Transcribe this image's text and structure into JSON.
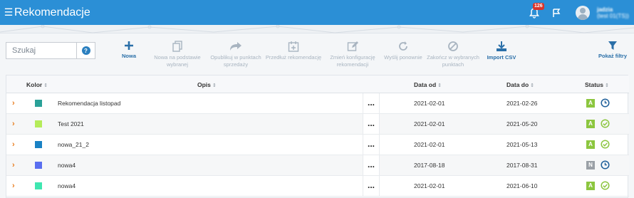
{
  "topbar": {
    "menu_icon": "hamburger-icon",
    "title": "Rekomendacje",
    "notification_count": "126",
    "user_name": "jadzia",
    "user_detail": "(test 01(TS))"
  },
  "search": {
    "placeholder": "Szukaj",
    "help_label": "?"
  },
  "toolbar": [
    {
      "label": "Nowa",
      "icon": "plus-icon",
      "enabled": true
    },
    {
      "label": "Nowa na podstawie\nwybranej",
      "icon": "copy-icon",
      "enabled": false
    },
    {
      "label": "Opublikuj w punktach\nsprzedaży",
      "icon": "share-icon",
      "enabled": false
    },
    {
      "label": "Przedłuż rekomendację",
      "icon": "calendar-plus-icon",
      "enabled": false
    },
    {
      "label": "Zmień konfigurację\nrekomendacji",
      "icon": "edit-icon",
      "enabled": false
    },
    {
      "label": "Wyślij ponownie",
      "icon": "refresh-icon",
      "enabled": false
    },
    {
      "label": "Zakończ w wybranych\npunktach",
      "icon": "ban-icon",
      "enabled": false
    },
    {
      "label": "Import CSV",
      "icon": "download-icon",
      "enabled": true
    },
    {
      "label": "Pokaż filtry",
      "icon": "filter-icon",
      "enabled": true
    }
  ],
  "table": {
    "columns": {
      "kolor": "Kolor",
      "opis": "Opis",
      "data_od": "Data od",
      "data_do": "Data do",
      "status": "Status"
    },
    "more_label": "...",
    "rows": [
      {
        "color": "#2aa198",
        "opis": "Rekomendacja listopad",
        "data_od": "2021-02-01",
        "data_do": "2021-02-26",
        "status": "A",
        "status_color": "#8cc63f",
        "status_icon": "clock-icon"
      },
      {
        "color": "#b5ec5a",
        "opis": "Test 2021",
        "data_od": "2021-02-01",
        "data_do": "2021-05-20",
        "status": "A",
        "status_color": "#8cc63f",
        "status_icon": "check-circle-icon"
      },
      {
        "color": "#1a82c4",
        "opis": "nowa_21_2",
        "data_od": "2021-02-01",
        "data_do": "2021-05-13",
        "status": "A",
        "status_color": "#8cc63f",
        "status_icon": "check-circle-icon"
      },
      {
        "color": "#5a6ff0",
        "opis": "nowa4",
        "data_od": "2017-08-18",
        "data_do": "2017-08-31",
        "status": "N",
        "status_color": "#9aa0a6",
        "status_icon": "clock-icon"
      },
      {
        "color": "#3fe6b0",
        "opis": "nowa4",
        "data_od": "2021-02-01",
        "data_do": "2021-06-10",
        "status": "A",
        "status_color": "#8cc63f",
        "status_icon": "check-circle-icon"
      }
    ]
  }
}
